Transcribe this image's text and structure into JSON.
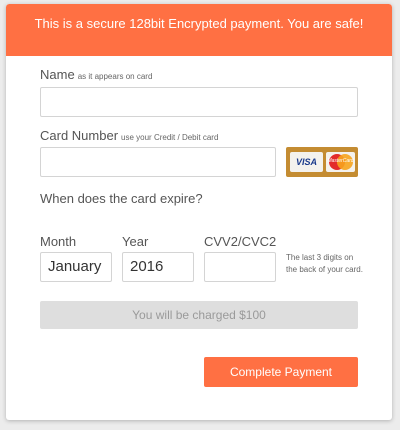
{
  "banner": {
    "text": "This is a secure 128bit Encrypted payment. You are safe!"
  },
  "name_field": {
    "label": "Name",
    "hint": "as it appears on card",
    "value": ""
  },
  "card_number_field": {
    "label": "Card Number",
    "hint": "use your Credit / Debit card",
    "value": ""
  },
  "card_logos": {
    "visa_text": "VISA",
    "mastercard_text": "MasterCard",
    "colors": {
      "box": "#c48c32",
      "visa_blue": "#1a3a8c",
      "mc_red": "#e32b2b",
      "mc_orange": "#f7a41d"
    }
  },
  "expiry_question": "When does the card expire?",
  "month_field": {
    "label": "Month",
    "value": "January"
  },
  "year_field": {
    "label": "Year",
    "value": "2016"
  },
  "cvv_field": {
    "label": "CVV2/CVC2",
    "value": "",
    "note": "The last 3 digits on the back of your card."
  },
  "charge_notice": "You will be charged $100",
  "submit_button": {
    "label": "Complete Payment"
  },
  "colors": {
    "accent": "#ff7043",
    "charge_bg": "#dedede"
  }
}
